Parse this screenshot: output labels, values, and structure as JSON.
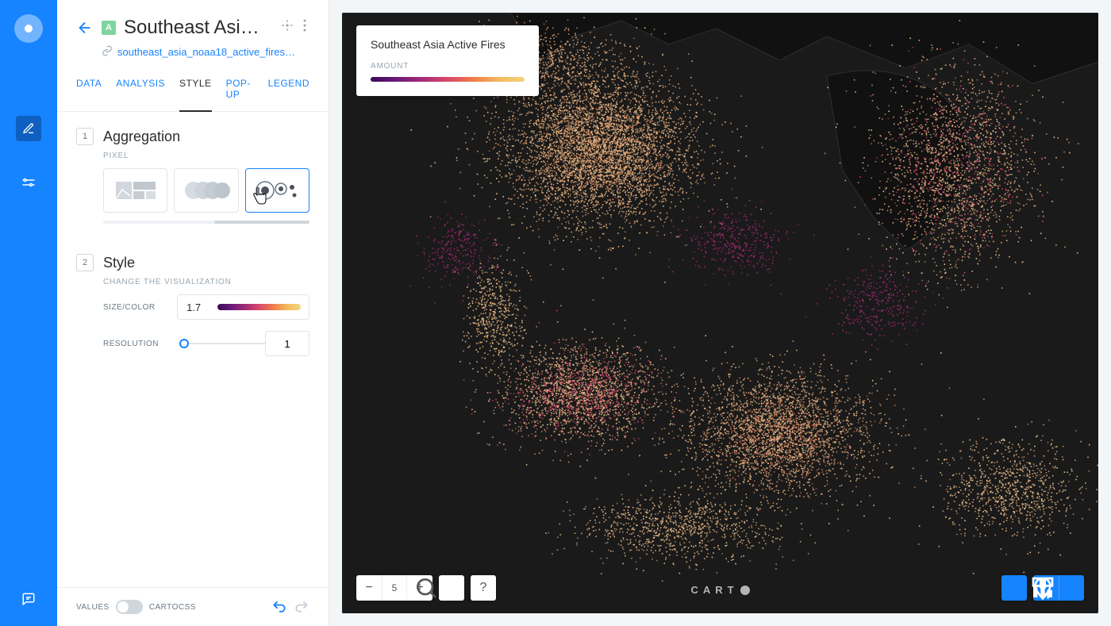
{
  "rail": {
    "feedback_icon": "feedback"
  },
  "header": {
    "title": "Southeast Asi…",
    "layer_badge": "A",
    "source": "southeast_asia_noaa18_active_fires…"
  },
  "tabs": {
    "data": "DATA",
    "analysis": "ANALYSIS",
    "style": "STYLE",
    "popup": "POP-UP",
    "legend": "LEGEND",
    "active": "style"
  },
  "aggregation": {
    "num": "1",
    "title": "Aggregation",
    "sub": "PIXEL",
    "options": [
      "admin-regions",
      "heatmap",
      "animated-pixel"
    ],
    "selected_index": 2
  },
  "style": {
    "num": "2",
    "title": "Style",
    "sub": "CHANGE THE VISUALIZATION",
    "sizecolor_label": "SIZE/COLOR",
    "sizecolor_value": "1.7",
    "resolution_label": "RESOLUTION",
    "resolution_value": "1"
  },
  "footer": {
    "values_label": "VALUES",
    "cartocss_label": "CARTOCSS"
  },
  "legend_card": {
    "title": "Southeast Asia Active Fires",
    "sub": "AMOUNT"
  },
  "map_controls": {
    "zoom_level": "5",
    "brand": "CART"
  },
  "colors": {
    "accent": "#1683ff",
    "map_bg": "#1a1a1a"
  }
}
